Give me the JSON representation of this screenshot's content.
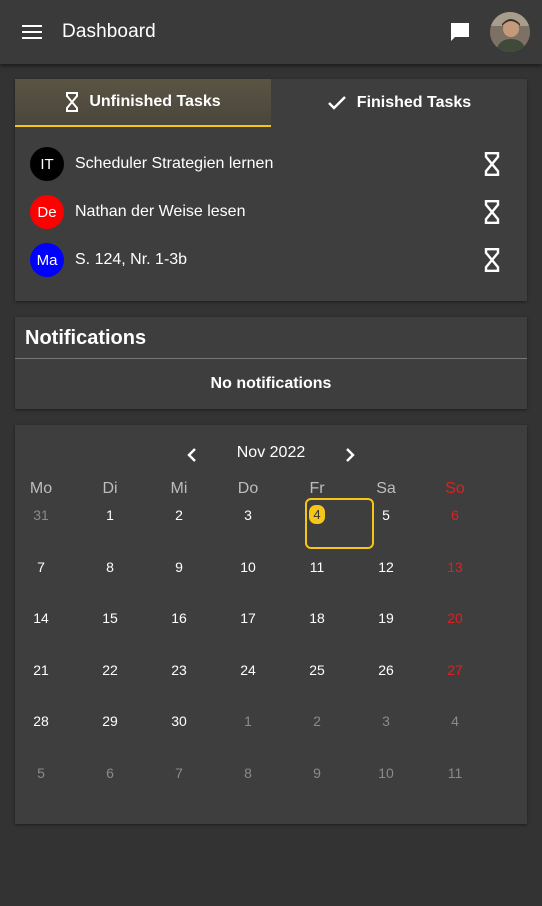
{
  "app": {
    "title": "Dashboard"
  },
  "tabs": [
    {
      "label": "Unfinished Tasks",
      "icon": "hourglass-icon",
      "active": true
    },
    {
      "label": "Finished Tasks",
      "icon": "check-icon",
      "active": false
    }
  ],
  "tasks": [
    {
      "subject": "IT",
      "color": "#000000",
      "label": "Scheduler Strategien lernen",
      "status_icon": "hourglass-icon"
    },
    {
      "subject": "De",
      "color": "#ff0000",
      "label": "Nathan der Weise lesen",
      "status_icon": "hourglass-icon"
    },
    {
      "subject": "Ma",
      "color": "#0000ff",
      "label": "S. 124, Nr. 1-3b",
      "status_icon": "hourglass-icon"
    }
  ],
  "notifications": {
    "title": "Notifications",
    "empty_text": "No notifications"
  },
  "calendar": {
    "month_label": "Nov 2022",
    "weekdays": [
      "Mo",
      "Di",
      "Mi",
      "Do",
      "Fr",
      "Sa",
      "So"
    ],
    "selected_day": "4",
    "weeks": [
      [
        "31",
        "1",
        "2",
        "3",
        "4",
        "5",
        "6"
      ],
      [
        "7",
        "8",
        "9",
        "10",
        "11",
        "12",
        "13"
      ],
      [
        "14",
        "15",
        "16",
        "17",
        "18",
        "19",
        "20"
      ],
      [
        "21",
        "22",
        "23",
        "24",
        "25",
        "26",
        "27"
      ],
      [
        "28",
        "29",
        "30",
        "1",
        "2",
        "3",
        "4"
      ],
      [
        "5",
        "6",
        "7",
        "8",
        "9",
        "10",
        "11"
      ]
    ],
    "outside_month": [
      [
        true,
        false,
        false,
        false,
        false,
        false,
        false
      ],
      [
        false,
        false,
        false,
        false,
        false,
        false,
        false
      ],
      [
        false,
        false,
        false,
        false,
        false,
        false,
        false
      ],
      [
        false,
        false,
        false,
        false,
        false,
        false,
        false
      ],
      [
        false,
        false,
        false,
        true,
        true,
        true,
        true
      ],
      [
        true,
        true,
        true,
        true,
        true,
        true,
        true
      ]
    ]
  },
  "colors": {
    "accent": "#f5c518",
    "sunday": "#e02020",
    "background": "#333333",
    "card": "#3e3e3e"
  }
}
